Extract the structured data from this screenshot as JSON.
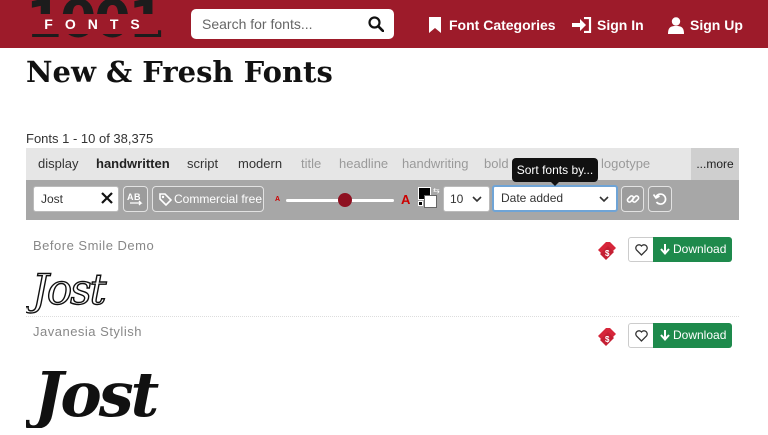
{
  "header": {
    "logo_digits": "1001",
    "logo_text": "FONTS",
    "search_placeholder": "Search for fonts...",
    "nav": {
      "categories": "Font Categories",
      "sign_in": "Sign In",
      "sign_up": "Sign Up"
    },
    "colors": {
      "brand": "#9d1b2a"
    }
  },
  "page": {
    "title": "New & Fresh Fonts",
    "count_text": "Fonts 1 - 10 of 38,375"
  },
  "categories": {
    "items": [
      {
        "label": "display",
        "style": "dark"
      },
      {
        "label": "handwritten",
        "style": "bold"
      },
      {
        "label": "script",
        "style": "dark"
      },
      {
        "label": "modern",
        "style": "dark"
      },
      {
        "label": "title",
        "style": "light"
      },
      {
        "label": "headline",
        "style": "light"
      },
      {
        "label": "handwriting",
        "style": "light"
      },
      {
        "label": "bold",
        "style": "light"
      },
      {
        "label": "logotype",
        "style": "light"
      }
    ],
    "more_label": "...more"
  },
  "toolbar": {
    "preview_text": "Jost",
    "commercial_free_label": "Commercial free",
    "size_level": 0.55,
    "per_page": "10",
    "sort_value": "Date added",
    "sort_tooltip": "Sort fonts by..."
  },
  "fonts": [
    {
      "name": "Before Smile Demo",
      "preview": "Jost",
      "download_label": "Download"
    },
    {
      "name": "Javanesia Stylish",
      "preview": "Jost",
      "download_label": "Download"
    }
  ]
}
